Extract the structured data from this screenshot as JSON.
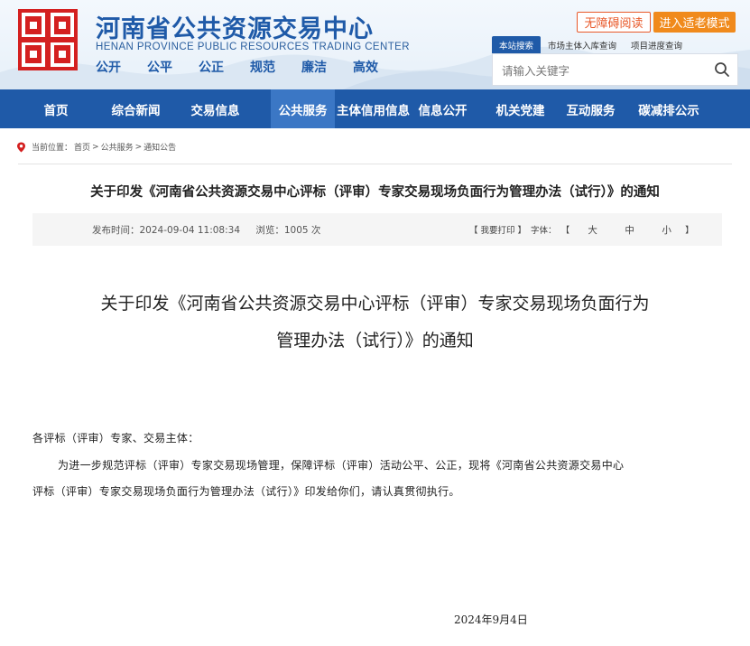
{
  "header": {
    "title_cn": "河南省公共资源交易中心",
    "title_en": "HENAN PROVINCE PUBLIC RESOURCES TRADING CENTER",
    "slogans": [
      "公开",
      "公平",
      "公正",
      "规范",
      "廉洁",
      "高效"
    ],
    "brand_color": "#1f5aa8",
    "accessibility_button": "无障碍阅读",
    "elderly_mode_button": "进入适老模式"
  },
  "search": {
    "tabs": [
      "本站搜索",
      "市场主体入库查询",
      "项目进度查询"
    ],
    "placeholder": "请输入关键字",
    "icon": "search-icon"
  },
  "nav": {
    "items": [
      "首页",
      "综合新闻",
      "交易信息",
      "公共服务",
      "主体信用信息",
      "信息公开",
      "机关党建",
      "互动服务",
      "碳减排公示"
    ],
    "active": "公共服务"
  },
  "breadcrumb": {
    "label": "当前位置：",
    "items": [
      "首页",
      "公共服务",
      "通知公告"
    ],
    "separator": ">"
  },
  "article": {
    "title": "关于印发《河南省公共资源交易中心评标（评审）专家交易现场负面行为管理办法（试行）》的通知",
    "publish_time": "发布时间：2024-09-04 11:08:34",
    "views": "浏览：1005 次",
    "print": "【 我要打印 】",
    "font_label": "字体：",
    "bracket_open": "【",
    "font_sizes": [
      "大",
      "中",
      "小"
    ],
    "bracket_close": "】",
    "doc_title_line1": "关于印发《河南省公共资源交易中心评标（评审）专家交易现场负面行为",
    "doc_title_line2": "管理办法（试行）》的通知",
    "salutation": "各评标（评审）专家、交易主体：",
    "para_line1": "为进一步规范评标（评审）专家交易现场管理，保障评标（评审）活动公平、公正，现将《河南省公共资源交易中心",
    "para_line2": "评标（评审）专家交易现场负面行为管理办法（试行）》印发给你们，请认真贯彻执行。",
    "date": "2024年9月4日"
  }
}
